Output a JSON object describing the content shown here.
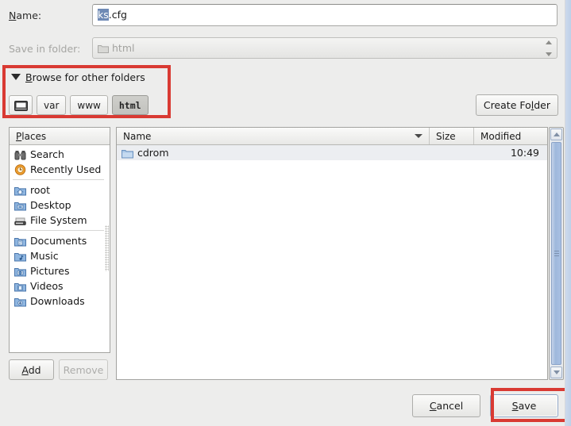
{
  "dialog": {
    "name_label": "Name:",
    "name_label_mnemonic": "N",
    "name_value_selected": "ks",
    "name_value_rest": ".cfg",
    "save_in_folder_label": "Save in folder:",
    "save_in_folder_value": "html",
    "expander_label": "Browse for other folders",
    "expander_mnemonic": "B",
    "expander_expanded": true
  },
  "breadcrumbs": {
    "items": [
      {
        "label": "",
        "icon": "filesystem-icon",
        "active": false
      },
      {
        "label": "var",
        "icon": "",
        "active": false
      },
      {
        "label": "www",
        "icon": "",
        "active": false
      },
      {
        "label": "html",
        "icon": "",
        "active": true
      }
    ],
    "create_folder_label": "Create Folder"
  },
  "places": {
    "header": "Places",
    "header_mnemonic": "P",
    "groups": [
      [
        {
          "label": "Search",
          "icon": "search-binoculars-icon"
        },
        {
          "label": "Recently Used",
          "icon": "recent-clock-icon"
        }
      ],
      [
        {
          "label": "root",
          "icon": "home-folder-icon"
        },
        {
          "label": "Desktop",
          "icon": "desktop-folder-icon"
        },
        {
          "label": "File System",
          "icon": "drive-harddisk-icon"
        }
      ],
      [
        {
          "label": "Documents",
          "icon": "documents-folder-icon"
        },
        {
          "label": "Music",
          "icon": "music-folder-icon"
        },
        {
          "label": "Pictures",
          "icon": "pictures-folder-icon"
        },
        {
          "label": "Videos",
          "icon": "videos-folder-icon"
        },
        {
          "label": "Downloads",
          "icon": "downloads-folder-icon"
        }
      ]
    ],
    "add_label": "Add",
    "add_mnemonic": "A",
    "remove_label": "Remove",
    "remove_enabled": false
  },
  "filelist": {
    "columns": [
      "Name",
      "Size",
      "Modified"
    ],
    "sort_column": "Name",
    "sort_direction": "descending",
    "rows": [
      {
        "name": "cdrom",
        "size": "",
        "modified": "10:49",
        "icon": "folder-icon",
        "highlighted": true
      }
    ]
  },
  "footer": {
    "cancel_label": "Cancel",
    "cancel_mnemonic": "C",
    "save_label": "Save",
    "save_mnemonic": "S"
  },
  "annotations": {
    "highlight_color": "#d93a33",
    "boxes": [
      {
        "target": "browse-for-other-folders-region"
      },
      {
        "target": "save-button"
      }
    ]
  },
  "colors": {
    "window_bg": "#ededec",
    "selection_blue": "#6f8ab5",
    "scrollbar_blue": "#a8c0e2",
    "row_highlight": "#eceef1",
    "disabled_text": "#a6a6a3"
  }
}
